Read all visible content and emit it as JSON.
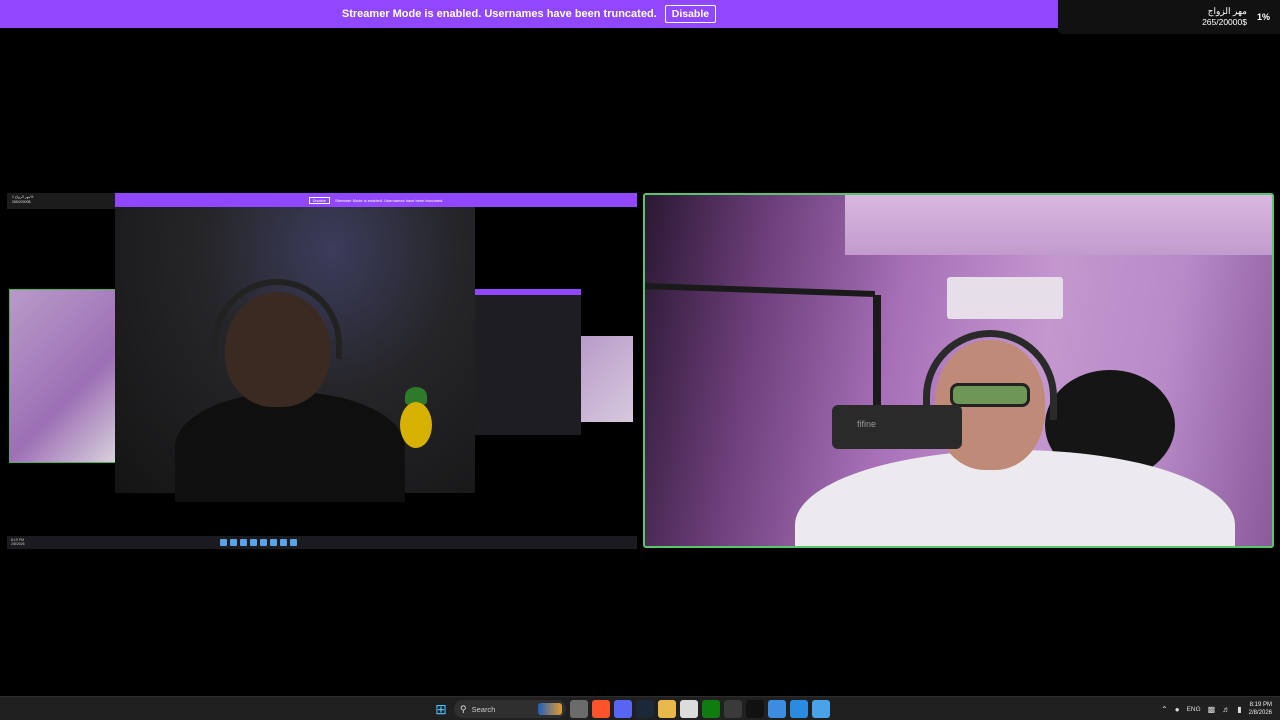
{
  "banner": {
    "message": "Streamer Mode is enabled. Usernames have been truncated.",
    "button": "Disable",
    "color": "#9147ff"
  },
  "goal": {
    "title": "مهر الزواج",
    "amount": "265/20000$",
    "percent": "1%"
  },
  "screen_share": {
    "mini_banner_text": "Streamer Mode is enabled. Usernames have been truncated.",
    "mini_banner_button": "Disable",
    "mini_goal_text": "مهر الزواج 1%",
    "mini_goal_amount": "265/20000$",
    "mini_clock_time": "8:19 PM",
    "mini_clock_date": "2/8/2026"
  },
  "webcam": {
    "border_color": "#58c66b",
    "mic_brand": "fifine"
  },
  "taskbar": {
    "search_placeholder": "Search",
    "language": "ENG",
    "time": "8:19 PM",
    "date": "2/8/2026",
    "pinned_apps": [
      {
        "name": "file-explorer-icon",
        "color": "#6b6b6b"
      },
      {
        "name": "brave-browser-icon",
        "color": "#fb542b"
      },
      {
        "name": "discord-icon",
        "color": "#5865f2"
      },
      {
        "name": "steam-icon",
        "color": "#1b2838"
      },
      {
        "name": "folder-icon",
        "color": "#e8b84a"
      },
      {
        "name": "calendar-icon",
        "color": "#dcdcdc"
      },
      {
        "name": "xbox-icon",
        "color": "#107c10"
      },
      {
        "name": "obs-icon",
        "color": "#3a3a3a"
      },
      {
        "name": "tiktok-icon",
        "color": "#111111"
      },
      {
        "name": "photos-icon",
        "color": "#3b8de0"
      },
      {
        "name": "vscode-icon",
        "color": "#2b8be0"
      },
      {
        "name": "app-icon",
        "color": "#4aa3e8"
      }
    ]
  }
}
